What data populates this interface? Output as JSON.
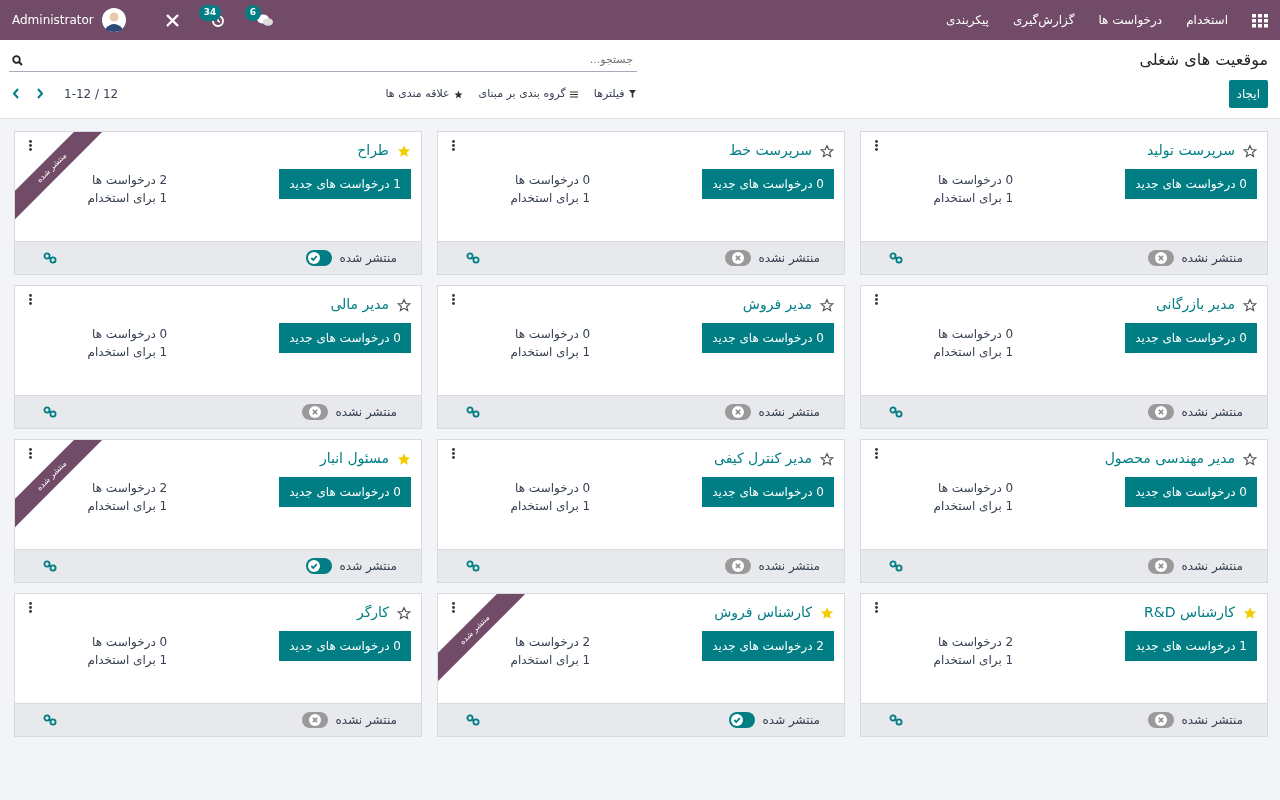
{
  "navbar": {
    "app_title": "استخدام",
    "menu": [
      "درخواست ها",
      "گزارش‌گیری",
      "پیکربندی"
    ],
    "user": "Administrator",
    "activity_count": "34",
    "message_count": "6"
  },
  "page_title": "موقعیت های شغلی",
  "search": {
    "placeholder": "جستجو..."
  },
  "create_button": "ایجاد",
  "filters": [
    {
      "kind": "filter",
      "label": "فیلترها"
    },
    {
      "kind": "group",
      "label": "گروه بندی بر مبنای"
    },
    {
      "kind": "favorites",
      "label": "علاقه مندی ها"
    }
  ],
  "pager": "1-12 / 12",
  "jobs": [
    {
      "title": "سرپرست تولید",
      "favorite": false,
      "new_button": "0 درخواست های جدید",
      "applications": "0 درخواست ها",
      "to_hire": "1 برای استخدام",
      "published": false,
      "status": "منتشر نشده"
    },
    {
      "title": "سرپرست خط",
      "favorite": false,
      "new_button": "0 درخواست های جدید",
      "applications": "0 درخواست ها",
      "to_hire": "1 برای استخدام",
      "published": false,
      "status": "منتشر نشده"
    },
    {
      "title": "طراح",
      "favorite": true,
      "new_button": "1 درخواست های جدید",
      "applications": "2 درخواست ها",
      "to_hire": "1 برای استخدام",
      "published": true,
      "status": "منتشر شده",
      "ribbon": "منتشر شده"
    },
    {
      "title": "مدیر بازرگانی",
      "favorite": false,
      "new_button": "0 درخواست های جدید",
      "applications": "0 درخواست ها",
      "to_hire": "1 برای استخدام",
      "published": false,
      "status": "منتشر نشده"
    },
    {
      "title": "مدیر فروش",
      "favorite": false,
      "new_button": "0 درخواست های جدید",
      "applications": "0 درخواست ها",
      "to_hire": "1 برای استخدام",
      "published": false,
      "status": "منتشر نشده"
    },
    {
      "title": "مدیر مالی",
      "favorite": false,
      "new_button": "0 درخواست های جدید",
      "applications": "0 درخواست ها",
      "to_hire": "1 برای استخدام",
      "published": false,
      "status": "منتشر نشده"
    },
    {
      "title": "مدیر مهندسی محصول",
      "favorite": false,
      "new_button": "0 درخواست های جدید",
      "applications": "0 درخواست ها",
      "to_hire": "1 برای استخدام",
      "published": false,
      "status": "منتشر نشده"
    },
    {
      "title": "مدیر کنترل کیفی",
      "favorite": false,
      "new_button": "0 درخواست های جدید",
      "applications": "0 درخواست ها",
      "to_hire": "1 برای استخدام",
      "published": false,
      "status": "منتشر نشده"
    },
    {
      "title": "مسئول انبار",
      "favorite": true,
      "new_button": "0 درخواست های جدید",
      "applications": "2 درخواست ها",
      "to_hire": "1 برای استخدام",
      "published": true,
      "status": "منتشر شده",
      "ribbon": "منتشر شده"
    },
    {
      "title": "کارشناس R&D",
      "favorite": true,
      "new_button": "1 درخواست های جدید",
      "applications": "2 درخواست ها",
      "to_hire": "1 برای استخدام",
      "published": false,
      "status": "منتشر نشده"
    },
    {
      "title": "کارشناس فروش",
      "favorite": true,
      "new_button": "2 درخواست های جدید",
      "applications": "2 درخواست ها",
      "to_hire": "1 برای استخدام",
      "published": true,
      "status": "منتشر شده",
      "ribbon": "منتشر شده"
    },
    {
      "title": "کارگر",
      "favorite": false,
      "new_button": "0 درخواست های جدید",
      "applications": "0 درخواست ها",
      "to_hire": "1 برای استخدام",
      "published": false,
      "status": "منتشر نشده"
    }
  ]
}
